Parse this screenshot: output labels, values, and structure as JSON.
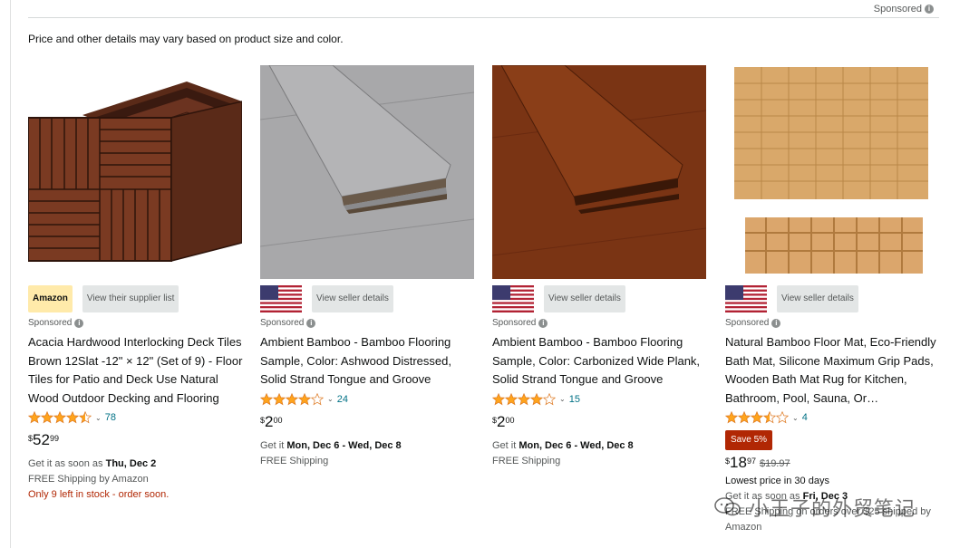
{
  "header": {
    "sponsored_label": "Sponsored",
    "disclaimer": "Price and other details may vary based on product size and color."
  },
  "products": [
    {
      "badge": "Amazon",
      "seller_button": "View their supplier list",
      "sponsored": "Sponsored",
      "title": "Acacia Hardwood Interlocking Deck Tiles Brown 12Slat -12\" × 12\" (Set of 9) - Floor Tiles for Patio and Deck Use Natural Wood Outdoor Decking and Flooring",
      "rating": 4.5,
      "rating_count": "78",
      "price_symbol": "$",
      "price_whole": "52",
      "price_fraction": "99",
      "delivery_prefix": "Get it as soon as ",
      "delivery_date": "Thu, Dec 2",
      "shipping": "FREE Shipping by Amazon",
      "stock": "Only 9 left in stock - order soon."
    },
    {
      "seller_button": "View seller details",
      "sponsored": "Sponsored",
      "title": "Ambient Bamboo - Bamboo Flooring Sample, Color: Ashwood Distressed, Solid Strand Tongue and Groove",
      "rating": 4.0,
      "rating_count": "24",
      "price_symbol": "$",
      "price_whole": "2",
      "price_fraction": "00",
      "delivery_prefix": "Get it ",
      "delivery_date": "Mon, Dec 6 - Wed, Dec 8",
      "shipping": "FREE Shipping"
    },
    {
      "seller_button": "View seller details",
      "sponsored": "Sponsored",
      "title": "Ambient Bamboo - Bamboo Flooring Sample, Color: Carbonized Wide Plank, Solid Strand Tongue and Groove",
      "rating": 4.0,
      "rating_count": "15",
      "price_symbol": "$",
      "price_whole": "2",
      "price_fraction": "00",
      "delivery_prefix": "Get it ",
      "delivery_date": "Mon, Dec 6 - Wed, Dec 8",
      "shipping": "FREE Shipping"
    },
    {
      "seller_button": "View seller details",
      "sponsored": "Sponsored",
      "title": "Natural Bamboo Floor Mat, Eco-Friendly Bath Mat, Silicone Maximum Grip Pads, Wooden Bath Mat Rug for Kitchen, Bathroom, Pool, Sauna, Or…",
      "rating": 3.5,
      "rating_count": "4",
      "save_badge": "Save 5%",
      "price_symbol": "$",
      "price_whole": "18",
      "price_fraction": "97",
      "price_was": "$19.97",
      "lowest_price": "Lowest price in 30 days",
      "delivery_prefix": "Get it as soon as ",
      "delivery_date": "Fri, Dec 3",
      "shipping": "FREE Shipping on orders over $25 shipped by Amazon"
    }
  ],
  "watermark": {
    "text": "小王子的外贸笔记",
    "icon": "wechat-icon"
  },
  "colors": {
    "star": "#ffa41c",
    "link": "#007185",
    "deal": "#b12704",
    "badge": "#ffeaaa"
  }
}
